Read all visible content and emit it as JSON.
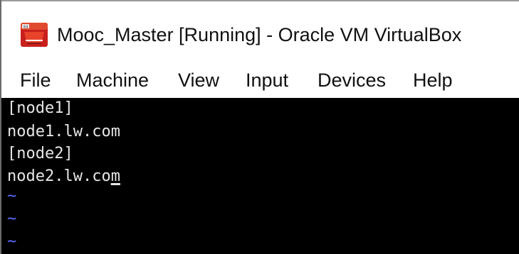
{
  "window": {
    "title": "Mooc_Master [Running] - Oracle VM VirtualBox",
    "icon": "virtualbox-icon",
    "background": "#ffffff"
  },
  "menu": {
    "items": [
      {
        "label": "File"
      },
      {
        "label": "Machine"
      },
      {
        "label": "View"
      },
      {
        "label": "Input"
      },
      {
        "label": "Devices"
      },
      {
        "label": "Help"
      }
    ]
  },
  "terminal": {
    "background": "#000000",
    "text_color": "#e6e6e6",
    "tilde_color": "#5a6cff",
    "lines": [
      "[node1]",
      "node1.lw.com",
      "[node2]"
    ],
    "cursor_line_prefix": "node2.lw.co",
    "cursor_char": "m",
    "empty_line_marker": "~"
  }
}
